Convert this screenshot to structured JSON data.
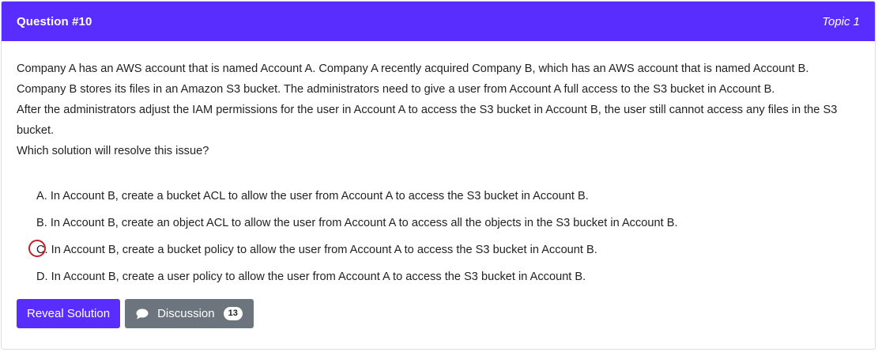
{
  "header": {
    "question_title": "Question #10",
    "topic": "Topic 1",
    "accent_color": "#5a2dff"
  },
  "question": {
    "paragraphs": [
      "Company A has an AWS account that is named Account A. Company A recently acquired Company B, which has an AWS account that is named Account B. Company B stores its files in an Amazon S3 bucket. The administrators need to give a user from Account A full access to the S3 bucket in Account B.",
      "After the administrators adjust the IAM permissions for the user in Account A to access the S3 bucket in Account B, the user still cannot access any files in the S3 bucket.",
      "Which solution will resolve this issue?"
    ]
  },
  "choices": [
    {
      "letter": "A.",
      "text": "In Account B, create a bucket ACL to allow the user from Account A to access the S3 bucket in Account B."
    },
    {
      "letter": "B.",
      "text": "In Account B, create an object ACL to allow the user from Account A to access all the objects in the S3 bucket in Account B."
    },
    {
      "letter": "C.",
      "text": "In Account B, create a bucket policy to allow the user from Account A to access the S3 bucket in Account B.",
      "marked": true
    },
    {
      "letter": "D.",
      "text": "In Account B, create a user policy to allow the user from Account A to access the S3 bucket in Account B."
    }
  ],
  "actions": {
    "reveal_label": "Reveal Solution",
    "discussion_label": "Discussion",
    "discussion_count": "13",
    "chat_icon": "comment-icon"
  },
  "colors": {
    "secondary": "#6c757d",
    "mark": "#c0202a"
  }
}
